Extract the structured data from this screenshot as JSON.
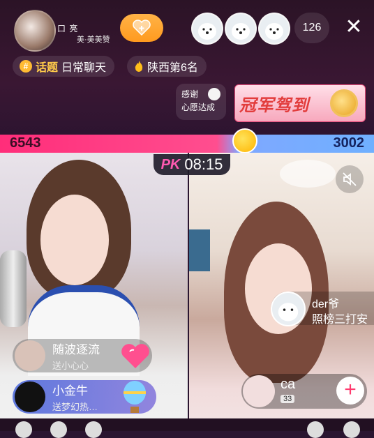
{
  "header": {
    "host_name": "口 亮",
    "host_sub": "美·美美赞",
    "viewer_count": "126",
    "close_icon": "close-icon"
  },
  "chips": {
    "topic_badge": "#",
    "topic_label": "话题",
    "topic_value": "日常聊天",
    "rank_label": "陕西第6名"
  },
  "thanks_card": {
    "line1": "感谢",
    "line2": "心愿达成"
  },
  "banner": {
    "text": "冠军驾到"
  },
  "pk": {
    "left_score": "6543",
    "right_score": "3002",
    "badge": "PK",
    "timer": "08:15",
    "left_color": "#ff2d7a",
    "right_color": "#6fb0ff"
  },
  "gifts": [
    {
      "name": "随波逐流",
      "desc": "送小心心",
      "icon": "heart-gift-icon"
    },
    {
      "name": "小金牛",
      "desc": "送梦幻热…",
      "icon": "hot-air-balloon-icon"
    }
  ],
  "overlay_user": {
    "name": "der爷",
    "desc": "照榜三打安"
  },
  "opponent": {
    "name": "ca",
    "level": "33"
  },
  "colors": {
    "accent": "#ff9a1f",
    "topic": "#ffcc4a",
    "banner_text": "#e23c3c"
  }
}
